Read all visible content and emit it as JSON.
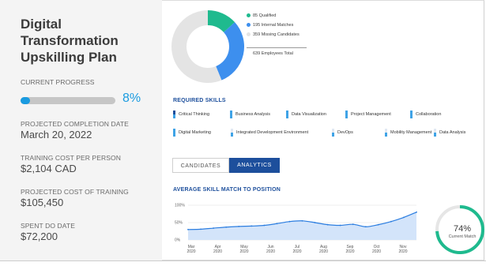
{
  "plan": {
    "title": "Digital Transformation Upskilling Plan",
    "progress_label": "CURRENT PROGRESS",
    "progress_value": 8,
    "progress_text": "8%",
    "completion_label": "PROJECTED COMPLETION DATE",
    "completion_value": "March 20, 2022",
    "cost_person_label": "TRAINING COST PER PERSON",
    "cost_person_value": "$2,104 CAD",
    "cost_total_label": "PROJECTED COST OF TRAINING",
    "cost_total_value": "$105,450",
    "spent_label": "SPENT DO DATE",
    "spent_value": "$72,200"
  },
  "donut": {
    "segments": [
      {
        "label": "85 Qualified",
        "value": 85,
        "color": "#1fba8e"
      },
      {
        "label": "195 Internal Matches",
        "value": 195,
        "color": "#3d8fee"
      },
      {
        "label": "359 Missing Candidates",
        "value": 359,
        "color": "#e4e4e4"
      }
    ],
    "total_text": "639 Employees Total"
  },
  "skills": {
    "heading": "REQUIRED SKILLS",
    "items": [
      {
        "label": "Critical Thinking",
        "top": "#1d4f9c",
        "bottom": "#3fa3e6"
      },
      {
        "label": "Business Analysis",
        "top": "#3fa3e6",
        "bottom": "#3fa3e6"
      },
      {
        "label": "Data Visualization",
        "top": "#3fa3e6",
        "bottom": "#3fa3e6"
      },
      {
        "label": "Project Management",
        "top": "#3fa3e6",
        "bottom": "#3fa3e6"
      },
      {
        "label": "Collaboration",
        "top": "#3fa3e6",
        "bottom": "#3fa3e6"
      },
      {
        "label": "Digital Marketing",
        "top": "#3fa3e6",
        "bottom": "#3fa3e6"
      },
      {
        "label": "Integrated Development Environment",
        "top": "#e1e8f2",
        "bottom": "#3fa3e6"
      },
      {
        "label": "DevOps",
        "top": "#e1e8f2",
        "bottom": "#3fa3e6"
      },
      {
        "label": "Mobility Management",
        "top": "#e1e8f2",
        "bottom": "#3fa3e6"
      },
      {
        "label": "Data Analysis",
        "top": "#e1e8f2",
        "bottom": "#3fa3e6"
      }
    ]
  },
  "tabs": {
    "candidates": "CANDIDATES",
    "analytics": "ANALYTICS"
  },
  "analytics": {
    "heading": "AVERAGE SKILL MATCH TO POSITION",
    "match_value": 74,
    "match_text": "74%",
    "match_label": "Current Match"
  },
  "chart_data": {
    "type": "area",
    "title": "AVERAGE SKILL MATCH TO POSITION",
    "xlabel": "",
    "ylabel": "",
    "ylim": [
      0,
      100
    ],
    "y_ticks": [
      "0%",
      "50%",
      "100%"
    ],
    "categories": [
      "Mar 2020",
      "Apr 2020",
      "May 2020",
      "Jun 2020",
      "Jul 2020",
      "Aug 2020",
      "Sep 2020",
      "Oct 2020",
      "Nov 2020"
    ],
    "tick_labels": [
      [
        "Mar",
        "2020"
      ],
      [
        "Apr",
        "2020"
      ],
      [
        "May",
        "2020"
      ],
      [
        "Jun",
        "2020"
      ],
      [
        "Jul",
        "2020"
      ],
      [
        "Aug",
        "2020"
      ],
      [
        "Sep",
        "2020"
      ],
      [
        "Oct",
        "2020"
      ],
      [
        "Nov",
        "2020"
      ]
    ],
    "x": [
      0,
      1,
      2,
      3,
      4,
      5,
      6,
      7,
      8,
      9,
      10,
      11,
      12,
      13,
      14,
      15,
      16,
      17,
      18
    ],
    "series": [
      {
        "values": [
          30,
          31,
          34,
          37,
          39,
          40,
          42,
          47,
          53,
          55,
          50,
          44,
          42,
          45,
          38,
          44,
          53,
          65,
          80
        ]
      }
    ],
    "grid": true,
    "colors": {
      "line": "#2b7de0",
      "fill": "#d3e4fa",
      "grid": "#e0e0e0"
    }
  }
}
